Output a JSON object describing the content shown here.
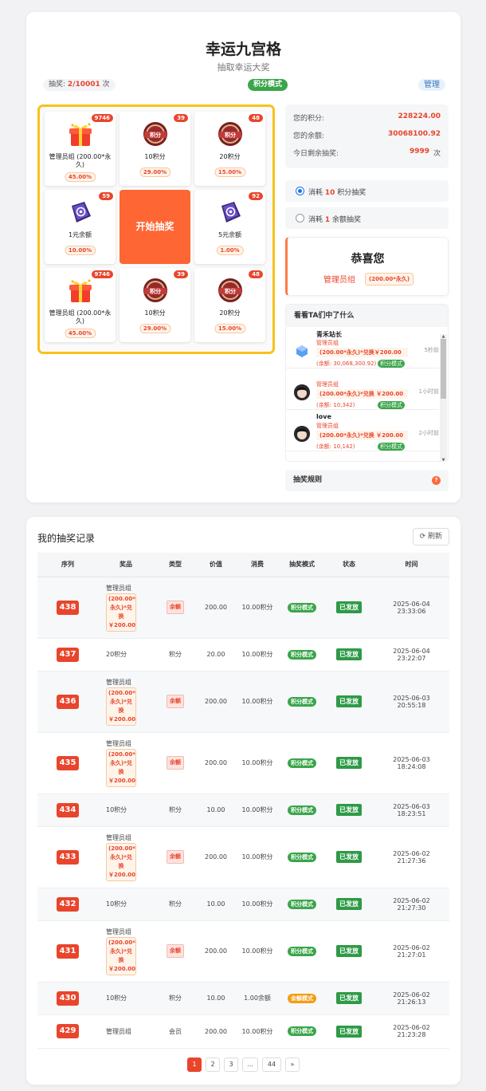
{
  "header": {
    "title": "幸运九宫格",
    "subtitle": "抽取幸运大奖"
  },
  "status": {
    "chances_label": "抽奖:",
    "chances_used": "2",
    "chances_sep": "/",
    "chances_total": "10001",
    "chances_unit": "次",
    "mode": "积分模式",
    "admin": "管理"
  },
  "grid": {
    "start": "开始抽奖",
    "cells": [
      {
        "count": "9746",
        "name": "管理员组 (200.00*永久)",
        "pct": "45.00%",
        "icon": "gift-icon"
      },
      {
        "count": "39",
        "name": "10积分",
        "pct": "29.00%",
        "icon": "points-badge-icon"
      },
      {
        "count": "48",
        "name": "20积分",
        "pct": "15.00%",
        "icon": "points-badge-icon"
      },
      {
        "count": "59",
        "name": "1元余额",
        "pct": "10.00%",
        "icon": "wallet-icon"
      },
      {
        "count": "92",
        "name": "5元余额",
        "pct": "1.00%",
        "icon": "wallet-icon"
      },
      {
        "count": "9746",
        "name": "管理员组 (200.00*永久)",
        "pct": "45.00%",
        "icon": "gift-icon"
      },
      {
        "count": "39",
        "name": "10积分",
        "pct": "29.00%",
        "icon": "points-badge-icon"
      },
      {
        "count": "48",
        "name": "20积分",
        "pct": "15.00%",
        "icon": "points-badge-icon"
      }
    ],
    "badge_text": "积分"
  },
  "account": {
    "points_label": "您的积分:",
    "points_value": "228224.00",
    "balance_label": "您的余额:",
    "balance_value": "30068100.92",
    "remain_label": "今日剩余抽奖:",
    "remain_value": "9999",
    "remain_unit": "次"
  },
  "options": [
    {
      "pre": "消耗",
      "num": "10",
      "post": "积分抽奖",
      "selected": true
    },
    {
      "pre": "消耗",
      "num": "1",
      "post": "余额抽奖",
      "selected": false
    }
  ],
  "win": {
    "heading": "恭喜您",
    "prize": "管理员组",
    "tag": "(200.00*永久)"
  },
  "feed": {
    "title": "看看TA们中了什么",
    "items": [
      {
        "user": "青禾站长",
        "level": "管理员组",
        "prize": "(200.00*永久)*兑换￥200.00",
        "bal": "(余额: 30,068,300.92)",
        "mode": "积分模式",
        "time": "5秒前"
      },
      {
        "user": "",
        "level": "管理员组",
        "prize": "(200.00*永久)*兑换 ￥200.00",
        "bal": "(余额: 10,342)",
        "mode": "积分模式",
        "time": "1小时前"
      },
      {
        "user": "love",
        "level": "管理员组",
        "prize": "(200.00*永久)*兑换 ￥200.00",
        "bal": "(余额: 10,142)",
        "mode": "积分模式",
        "time": "2小时前"
      }
    ]
  },
  "rules": {
    "label": "抽奖规则",
    "icon": "question-icon"
  },
  "records": {
    "title": "我的抽奖记录",
    "refresh": "刷新",
    "columns": [
      "序列",
      "奖品",
      "类型",
      "价值",
      "消费",
      "抽奖模式",
      "状态",
      "时间"
    ],
    "rows": [
      {
        "id": "438",
        "prize": "管理员组",
        "tag": "(200.00*永久)*兑换￥200.00",
        "type": "余额",
        "value": "200.00",
        "cost": "10.00积分",
        "mode": "积分模式",
        "status": "已发放",
        "date": "2025-06-04",
        "time": "23:33:06"
      },
      {
        "id": "437",
        "prize": "20积分",
        "tag": "",
        "type": "积分",
        "value": "20.00",
        "cost": "10.00积分",
        "mode": "积分模式",
        "status": "已发放",
        "date": "2025-06-04",
        "time": "23:22:07"
      },
      {
        "id": "436",
        "prize": "管理员组",
        "tag": "(200.00*永久)*兑换￥200.00",
        "type": "余额",
        "value": "200.00",
        "cost": "10.00积分",
        "mode": "积分模式",
        "status": "已发放",
        "date": "2025-06-03",
        "time": "20:55:18"
      },
      {
        "id": "435",
        "prize": "管理员组",
        "tag": "(200.00*永久)*兑换￥200.00",
        "type": "余额",
        "value": "200.00",
        "cost": "10.00积分",
        "mode": "积分模式",
        "status": "已发放",
        "date": "2025-06-03",
        "time": "18:24:08"
      },
      {
        "id": "434",
        "prize": "10积分",
        "tag": "",
        "type": "积分",
        "value": "10.00",
        "cost": "10.00积分",
        "mode": "积分模式",
        "status": "已发放",
        "date": "2025-06-03",
        "time": "18:23:51"
      },
      {
        "id": "433",
        "prize": "管理员组",
        "tag": "(200.00*永久)*兑换￥200.00",
        "type": "余额",
        "value": "200.00",
        "cost": "10.00积分",
        "mode": "积分模式",
        "status": "已发放",
        "date": "2025-06-02",
        "time": "21:27:36"
      },
      {
        "id": "432",
        "prize": "10积分",
        "tag": "",
        "type": "积分",
        "value": "10.00",
        "cost": "10.00积分",
        "mode": "积分模式",
        "status": "已发放",
        "date": "2025-06-02",
        "time": "21:27:30"
      },
      {
        "id": "431",
        "prize": "管理员组",
        "tag": "(200.00*永久)*兑换￥200.00",
        "type": "余额",
        "value": "200.00",
        "cost": "10.00积分",
        "mode": "积分模式",
        "status": "已发放",
        "date": "2025-06-02",
        "time": "21:27:01"
      },
      {
        "id": "430",
        "prize": "10积分",
        "tag": "",
        "type": "积分",
        "value": "10.00",
        "cost": "1.00余额",
        "mode": "余额模式",
        "status": "已发放",
        "date": "2025-06-02",
        "time": "21:26:13"
      },
      {
        "id": "429",
        "prize": "管理员组",
        "tag": "",
        "type": "会员",
        "value": "200.00",
        "cost": "10.00积分",
        "mode": "积分模式",
        "status": "已发放",
        "date": "2025-06-02",
        "time": "21:23:28"
      }
    ]
  },
  "pagination": {
    "pages": [
      "1",
      "2",
      "3",
      "...",
      "44"
    ],
    "next": "»"
  },
  "colors": {
    "accent": "#e8452c",
    "start": "#fe6633",
    "frame": "#f8c21c",
    "success": "#3aa54a"
  }
}
